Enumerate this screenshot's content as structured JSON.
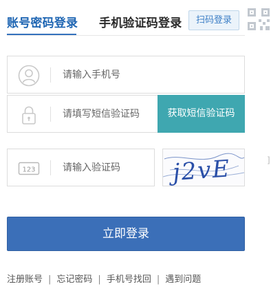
{
  "tabs": {
    "account_password": "账号密码登录",
    "phone_code": "手机验证码登录",
    "qr_badge": "扫码登录"
  },
  "form": {
    "phone_placeholder": "请输入手机号",
    "sms_placeholder": "请填写短信验证码",
    "sms_button": "获取短信验证码",
    "captcha_placeholder": "请输入验证码",
    "captcha_icon_text": "123",
    "captcha_image_text": "j2vE"
  },
  "login_button": "立即登录",
  "footer": {
    "register": "注册账号",
    "forgot_password": "忘记密码",
    "phone_recover": "手机号找回",
    "help": "遇到问题",
    "separator": "|"
  },
  "colors": {
    "active_tab": "#1f66b3",
    "sms_button_bg": "#3fa7b0",
    "login_button_bg": "#3b6fb8",
    "qr_badge_bg": "#ebf3fa"
  },
  "icons": [
    "user-icon",
    "lock-icon",
    "captcha-123-icon",
    "qr-code-icon"
  ]
}
